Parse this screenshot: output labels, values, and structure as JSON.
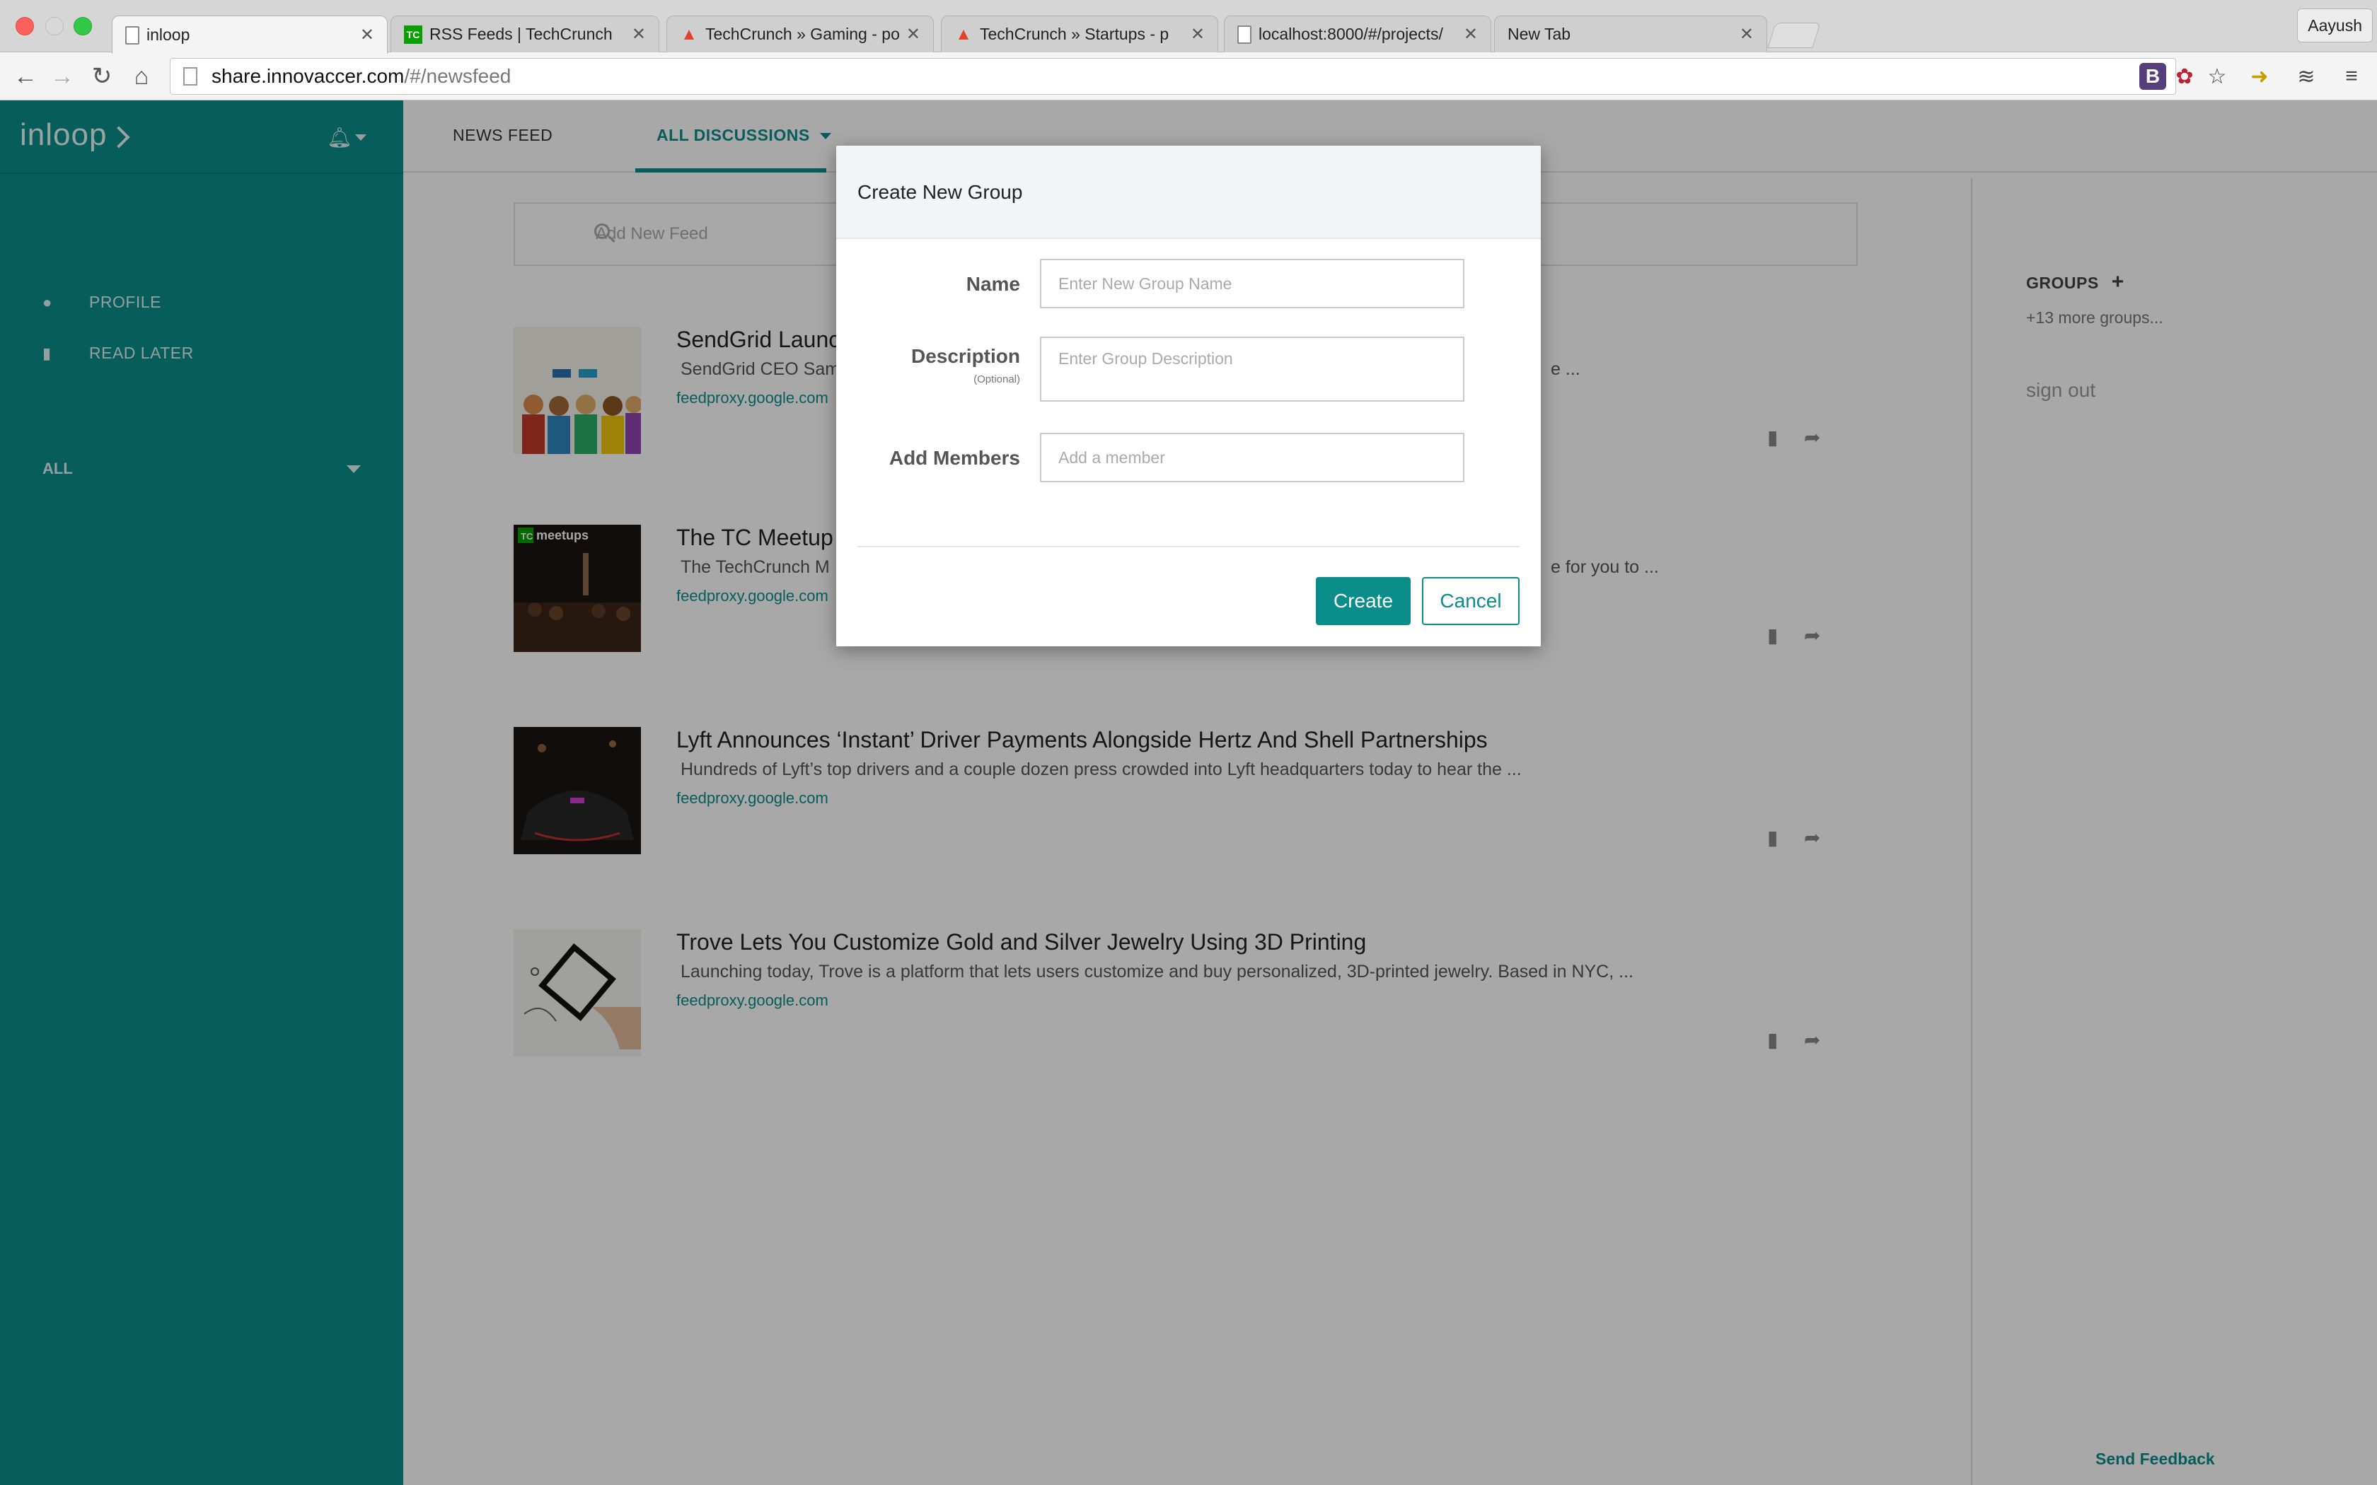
{
  "browser": {
    "tabs": [
      {
        "title": "inloop",
        "icon": "page-icon",
        "active": true
      },
      {
        "title": "RSS Feeds | TechCrunch",
        "icon": "techcrunch-icon",
        "active": false
      },
      {
        "title": "TechCrunch » Gaming - po",
        "icon": "feed-flame-icon",
        "active": false
      },
      {
        "title": "TechCrunch » Startups - p",
        "icon": "feed-flame-icon",
        "active": false
      },
      {
        "title": "localhost:8000/#/projects/",
        "icon": "page-icon",
        "active": false
      },
      {
        "title": "New Tab",
        "icon": "",
        "active": false
      }
    ],
    "tab_close": "✕",
    "user": "Aayush",
    "url_host": "share.innovaccer.com",
    "url_path": "/#/newsfeed"
  },
  "app": {
    "brand": "inloop",
    "accent_color": "#0b8d8a",
    "sidebar": {
      "items": [
        {
          "label": "PROFILE",
          "icon": "person-icon"
        },
        {
          "label": "READ LATER",
          "icon": "bookmark-icon"
        }
      ],
      "filter": "ALL"
    },
    "nav": {
      "news_feed": "NEWS FEED",
      "all_discussions": "ALL DISCUSSIONS"
    },
    "feed_input_placeholder": "Add New Feed",
    "articles": [
      {
        "title": "SendGrid Launc",
        "desc": "SendGrid CEO Sam",
        "desc_tail": "e ...",
        "source": "feedproxy.google.com"
      },
      {
        "title": "The TC Meetup",
        "desc": "The TechCrunch M",
        "desc_tail": "e for you to ...",
        "source": "feedproxy.google.com"
      },
      {
        "title": "Lyft Announces ‘Instant’ Driver Payments Alongside Hertz And Shell Partnerships",
        "desc": "Hundreds of Lyft’s top drivers and a couple dozen press crowded into Lyft headquarters today to hear the ...",
        "source": "feedproxy.google.com"
      },
      {
        "title": "Trove Lets You Customize Gold and Silver Jewelry Using 3D Printing",
        "desc": "Launching today, Trove is a platform that lets users customize and buy personalized, 3D-printed jewelry. Based in NYC, ...",
        "source": "feedproxy.google.com"
      }
    ],
    "thumb2_text": "meetups",
    "right": {
      "groups_label": "GROUPS",
      "more_groups": "+13 more groups...",
      "sign_out": "sign out",
      "send_feedback": "Send Feedback"
    }
  },
  "modal": {
    "title": "Create New Group",
    "name_label": "Name",
    "name_placeholder": "Enter New Group Name",
    "description_label": "Description",
    "description_hint": "(Optional)",
    "description_placeholder": "Enter Group Description",
    "members_label": "Add Members",
    "members_placeholder": "Add a member",
    "create_label": "Create",
    "cancel_label": "Cancel"
  }
}
